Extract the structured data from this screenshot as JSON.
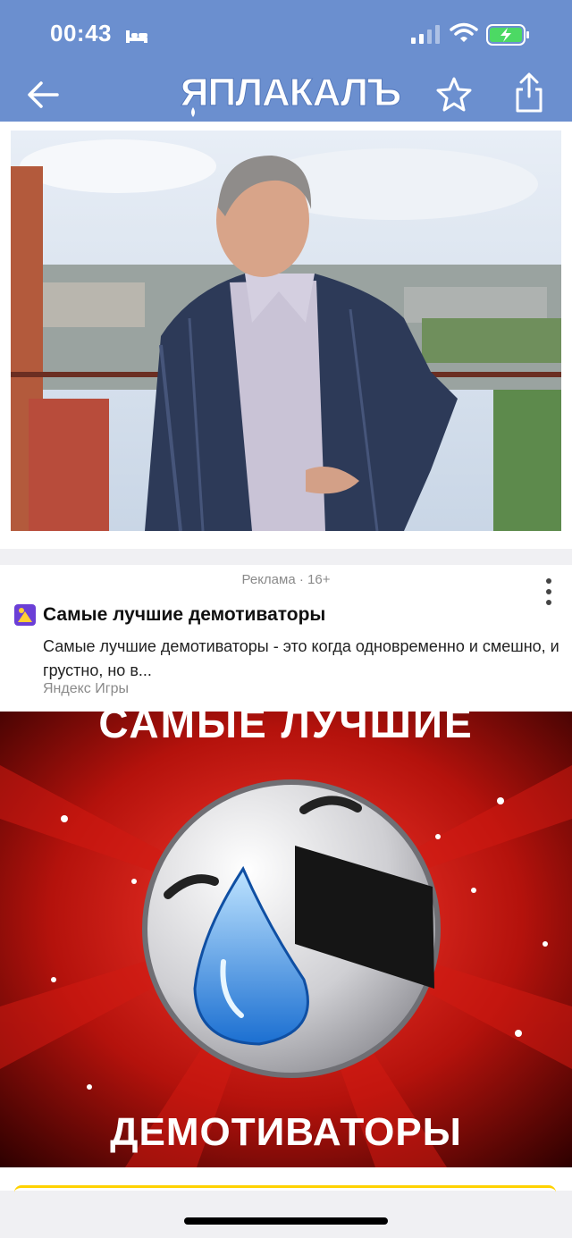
{
  "status_bar": {
    "time": "00:43"
  },
  "header": {
    "logo_text": "ЯПЛАКАЛЪ",
    "colors": {
      "bar": "#6b8fcf"
    }
  },
  "icons": {
    "back": "arrow-left-icon",
    "favorite": "star-icon",
    "share": "share-icon",
    "more": "more-vertical-icon",
    "ad": "game-icon"
  },
  "ad": {
    "label": "Реклама · 16+",
    "title": "Самые лучшие демотиваторы",
    "description": "Самые лучшие демотиваторы - это когда одновременно и смешно, и грустно, но в...",
    "source": "Яндекс Игры",
    "banner_top_text": "САМЫЕ ЛУЧШИЕ",
    "banner_bottom_text": "ДЕМОТИВАТОРЫ"
  }
}
